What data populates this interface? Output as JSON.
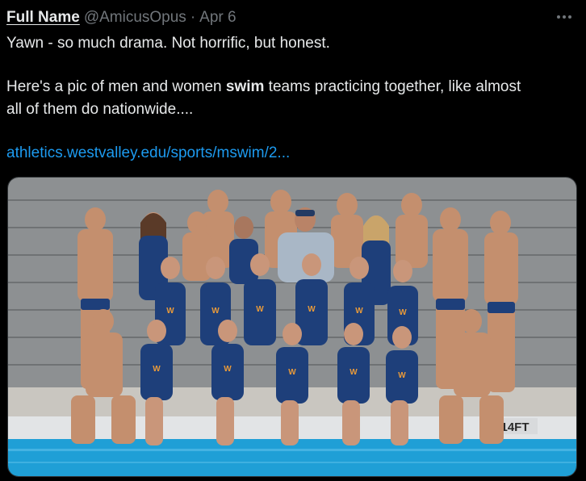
{
  "tweet": {
    "display_name": "Full Name",
    "handle": "@AmicusOpus",
    "separator": "·",
    "date": "Apr 6",
    "text_line1": "Yawn - so much drama. Not horrific, but honest.",
    "text_line2_before": "Here's a pic of men and women ",
    "text_line2_bold": "swim",
    "text_line2_after": " teams practicing together, like almost",
    "text_line3": "all of them do nationwide....",
    "link_text": "athletics.westvalley.edu/sports/mswim/2...",
    "more_icon": "more-horizontal-icon"
  },
  "photo": {
    "pool_marker": "14FT",
    "colors": {
      "background": "#000000",
      "text": "#e7e9ea",
      "secondary": "#71767b",
      "link": "#1d9bf0",
      "pool_water": "#1f9fd6",
      "swimsuit": "#1e3f7a",
      "bleachers": "#8a8d8f"
    }
  }
}
